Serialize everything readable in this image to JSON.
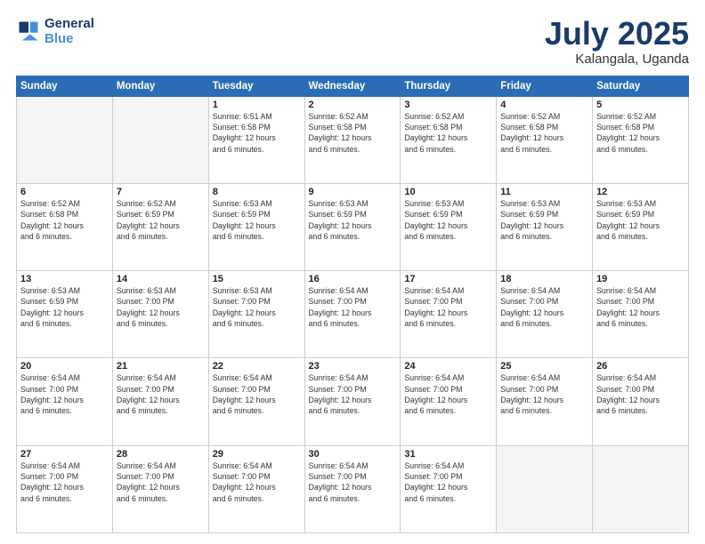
{
  "header": {
    "logo_line1": "General",
    "logo_line2": "Blue",
    "month": "July 2025",
    "location": "Kalangala, Uganda"
  },
  "weekdays": [
    "Sunday",
    "Monday",
    "Tuesday",
    "Wednesday",
    "Thursday",
    "Friday",
    "Saturday"
  ],
  "weeks": [
    [
      {
        "day": "",
        "info": ""
      },
      {
        "day": "",
        "info": ""
      },
      {
        "day": "1",
        "info": "Sunrise: 6:51 AM\nSunset: 6:58 PM\nDaylight: 12 hours\nand 6 minutes."
      },
      {
        "day": "2",
        "info": "Sunrise: 6:52 AM\nSunset: 6:58 PM\nDaylight: 12 hours\nand 6 minutes."
      },
      {
        "day": "3",
        "info": "Sunrise: 6:52 AM\nSunset: 6:58 PM\nDaylight: 12 hours\nand 6 minutes."
      },
      {
        "day": "4",
        "info": "Sunrise: 6:52 AM\nSunset: 6:58 PM\nDaylight: 12 hours\nand 6 minutes."
      },
      {
        "day": "5",
        "info": "Sunrise: 6:52 AM\nSunset: 6:58 PM\nDaylight: 12 hours\nand 6 minutes."
      }
    ],
    [
      {
        "day": "6",
        "info": "Sunrise: 6:52 AM\nSunset: 6:58 PM\nDaylight: 12 hours\nand 6 minutes."
      },
      {
        "day": "7",
        "info": "Sunrise: 6:52 AM\nSunset: 6:59 PM\nDaylight: 12 hours\nand 6 minutes."
      },
      {
        "day": "8",
        "info": "Sunrise: 6:53 AM\nSunset: 6:59 PM\nDaylight: 12 hours\nand 6 minutes."
      },
      {
        "day": "9",
        "info": "Sunrise: 6:53 AM\nSunset: 6:59 PM\nDaylight: 12 hours\nand 6 minutes."
      },
      {
        "day": "10",
        "info": "Sunrise: 6:53 AM\nSunset: 6:59 PM\nDaylight: 12 hours\nand 6 minutes."
      },
      {
        "day": "11",
        "info": "Sunrise: 6:53 AM\nSunset: 6:59 PM\nDaylight: 12 hours\nand 6 minutes."
      },
      {
        "day": "12",
        "info": "Sunrise: 6:53 AM\nSunset: 6:59 PM\nDaylight: 12 hours\nand 6 minutes."
      }
    ],
    [
      {
        "day": "13",
        "info": "Sunrise: 6:53 AM\nSunset: 6:59 PM\nDaylight: 12 hours\nand 6 minutes."
      },
      {
        "day": "14",
        "info": "Sunrise: 6:53 AM\nSunset: 7:00 PM\nDaylight: 12 hours\nand 6 minutes."
      },
      {
        "day": "15",
        "info": "Sunrise: 6:53 AM\nSunset: 7:00 PM\nDaylight: 12 hours\nand 6 minutes."
      },
      {
        "day": "16",
        "info": "Sunrise: 6:54 AM\nSunset: 7:00 PM\nDaylight: 12 hours\nand 6 minutes."
      },
      {
        "day": "17",
        "info": "Sunrise: 6:54 AM\nSunset: 7:00 PM\nDaylight: 12 hours\nand 6 minutes."
      },
      {
        "day": "18",
        "info": "Sunrise: 6:54 AM\nSunset: 7:00 PM\nDaylight: 12 hours\nand 6 minutes."
      },
      {
        "day": "19",
        "info": "Sunrise: 6:54 AM\nSunset: 7:00 PM\nDaylight: 12 hours\nand 6 minutes."
      }
    ],
    [
      {
        "day": "20",
        "info": "Sunrise: 6:54 AM\nSunset: 7:00 PM\nDaylight: 12 hours\nand 6 minutes."
      },
      {
        "day": "21",
        "info": "Sunrise: 6:54 AM\nSunset: 7:00 PM\nDaylight: 12 hours\nand 6 minutes."
      },
      {
        "day": "22",
        "info": "Sunrise: 6:54 AM\nSunset: 7:00 PM\nDaylight: 12 hours\nand 6 minutes."
      },
      {
        "day": "23",
        "info": "Sunrise: 6:54 AM\nSunset: 7:00 PM\nDaylight: 12 hours\nand 6 minutes."
      },
      {
        "day": "24",
        "info": "Sunrise: 6:54 AM\nSunset: 7:00 PM\nDaylight: 12 hours\nand 6 minutes."
      },
      {
        "day": "25",
        "info": "Sunrise: 6:54 AM\nSunset: 7:00 PM\nDaylight: 12 hours\nand 6 minutes."
      },
      {
        "day": "26",
        "info": "Sunrise: 6:54 AM\nSunset: 7:00 PM\nDaylight: 12 hours\nand 6 minutes."
      }
    ],
    [
      {
        "day": "27",
        "info": "Sunrise: 6:54 AM\nSunset: 7:00 PM\nDaylight: 12 hours\nand 6 minutes."
      },
      {
        "day": "28",
        "info": "Sunrise: 6:54 AM\nSunset: 7:00 PM\nDaylight: 12 hours\nand 6 minutes."
      },
      {
        "day": "29",
        "info": "Sunrise: 6:54 AM\nSunset: 7:00 PM\nDaylight: 12 hours\nand 6 minutes."
      },
      {
        "day": "30",
        "info": "Sunrise: 6:54 AM\nSunset: 7:00 PM\nDaylight: 12 hours\nand 6 minutes."
      },
      {
        "day": "31",
        "info": "Sunrise: 6:54 AM\nSunset: 7:00 PM\nDaylight: 12 hours\nand 6 minutes."
      },
      {
        "day": "",
        "info": ""
      },
      {
        "day": "",
        "info": ""
      }
    ]
  ]
}
